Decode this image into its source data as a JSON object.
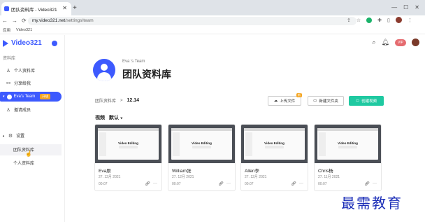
{
  "browser": {
    "tab_title": "团队资料库 - Video321",
    "new_tab": "+",
    "url_host": "my.video321.net",
    "url_path": "/settings/team",
    "bookmarks": [
      "应用",
      "Video321"
    ]
  },
  "sidebar": {
    "brand": "Video321",
    "section_library": "资料库",
    "items": [
      {
        "label": "个人资料库"
      },
      {
        "label": "分享给我"
      }
    ],
    "team_name": "Eva's Team",
    "team_badge": "升级",
    "invite_label": "邀请成员",
    "settings_label": "设置",
    "settings_items": [
      {
        "label": "团队资料库"
      },
      {
        "label": "个人资料库"
      }
    ]
  },
  "topbar": {
    "vip": "VIP"
  },
  "header": {
    "team_owner": "Eva 's Team",
    "title": "团队资料库"
  },
  "breadcrumb": {
    "root": "团队资料库",
    "sep": ">",
    "current": "12.14"
  },
  "actions": {
    "upload": "上传文件",
    "upload_hot": "新",
    "new_folder": "新建文件夹",
    "create_video": "创建视频"
  },
  "filters": {
    "type": "视频",
    "sort": "默认"
  },
  "cards": [
    {
      "name": "Eva原",
      "date": "27. 12月 2021",
      "duration": "00:07",
      "thumb_title": "Video Editing"
    },
    {
      "name": "William张",
      "date": "27. 12月 2021",
      "duration": "00:07",
      "thumb_title": "Video Editing"
    },
    {
      "name": "Allen李",
      "date": "27. 12月 2021",
      "duration": "00:07",
      "thumb_title": "Video Editing"
    },
    {
      "name": "Chris杨",
      "date": "27. 11月 2021",
      "duration": "00:07",
      "thumb_title": "Video Editing"
    }
  ],
  "watermark": "最需教育",
  "colors": {
    "accent": "#3d5afe",
    "primary_button": "#1fc9a1"
  }
}
